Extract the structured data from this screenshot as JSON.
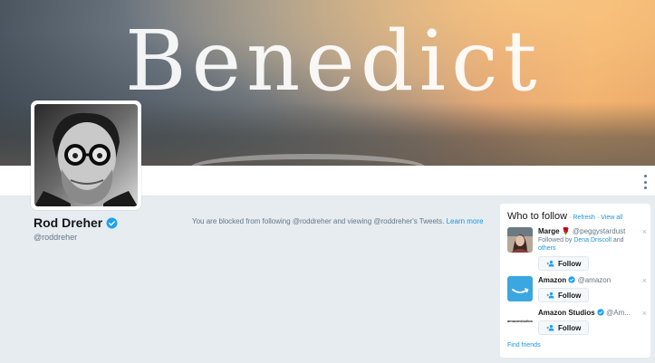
{
  "banner": {
    "title": "Benedict"
  },
  "profile": {
    "name": "Rod Dreher",
    "handle": "@roddreher",
    "verified": true
  },
  "blocked_notice": {
    "text": "You are blocked from following @roddreher and viewing @roddreher's Tweets.",
    "link": "Learn more"
  },
  "who_to_follow": {
    "title": "Who to follow",
    "separator": "·",
    "refresh": "Refresh",
    "view_all": "View all",
    "follow_label": "Follow",
    "dismiss": "×",
    "find_friends": "Find friends",
    "items": [
      {
        "name": "Marge",
        "emoji": "🌹",
        "handle": "@peggystardust",
        "followed_by_prefix": "Followed by",
        "followed_by": "Dena Driscoll",
        "and": "and",
        "others": "others",
        "verified": false
      },
      {
        "name": "Amazon",
        "handle": "@amazon",
        "verified": true,
        "logo_text": ""
      },
      {
        "name": "Amazon Studios",
        "handle": "@Am...",
        "verified": true,
        "logo_text": "amazonstudios"
      }
    ]
  },
  "colors": {
    "link": "#1b95e0",
    "verified": "#1da1f2",
    "background": "#e6ecf0",
    "amazon_blue": "#3ba7e0"
  }
}
